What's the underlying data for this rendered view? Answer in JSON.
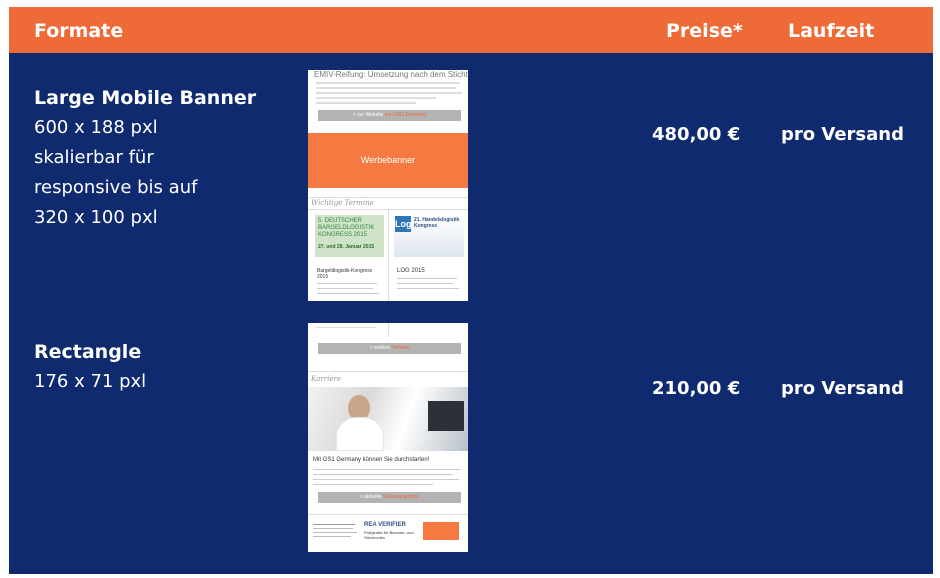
{
  "header": {
    "formats": "Formate",
    "prices": "Preise*",
    "runtime": "Laufzeit"
  },
  "rows": [
    {
      "name": "Large Mobile Banner",
      "lines": [
        "600 x 188 pxl",
        "skalierbar für",
        "responsive bis auf",
        "320 x 100 pxl"
      ],
      "price": "480,00 €",
      "runtime": "pro Versand",
      "preview": {
        "headline": "EMIV-Reifung: Umsetzung nach dem Stichtag",
        "button": "> zur Website ",
        "button_accent": "von GS1 Germany",
        "banner": "Werbebanner",
        "section": "Wichtige Termine",
        "event1_title": "5. DEUTSCHER BARGELDLOGISTIK KONGRESS 2015",
        "event1_date": "27. und 28. Januar 2015",
        "event1_link": "Bargeldlogistik-Kongress 2015",
        "event2_logo": "Log",
        "event2_title": "21. Handelslogistik Kongress",
        "event2_link": "LOG 2015"
      }
    },
    {
      "name": "Rectangle",
      "lines": [
        "176 x 71 pxl"
      ],
      "price": "210,00 €",
      "runtime": "pro Versand",
      "preview": {
        "button": "> weitere ",
        "button_accent": "Termine",
        "section": "Karriere",
        "headline": "Mit GS1 Germany können Sie durchstarten!",
        "button2": "> aktuelle ",
        "button2_accent": "Stellenangebote",
        "ad_brand": "REA VERIFIER",
        "ad_text": "Prüfgeräte für Barcode- und Strichcodes"
      }
    }
  ],
  "colors": {
    "header": "#ee6a36",
    "background": "#0f2a6e",
    "banner": "#f47a42"
  }
}
